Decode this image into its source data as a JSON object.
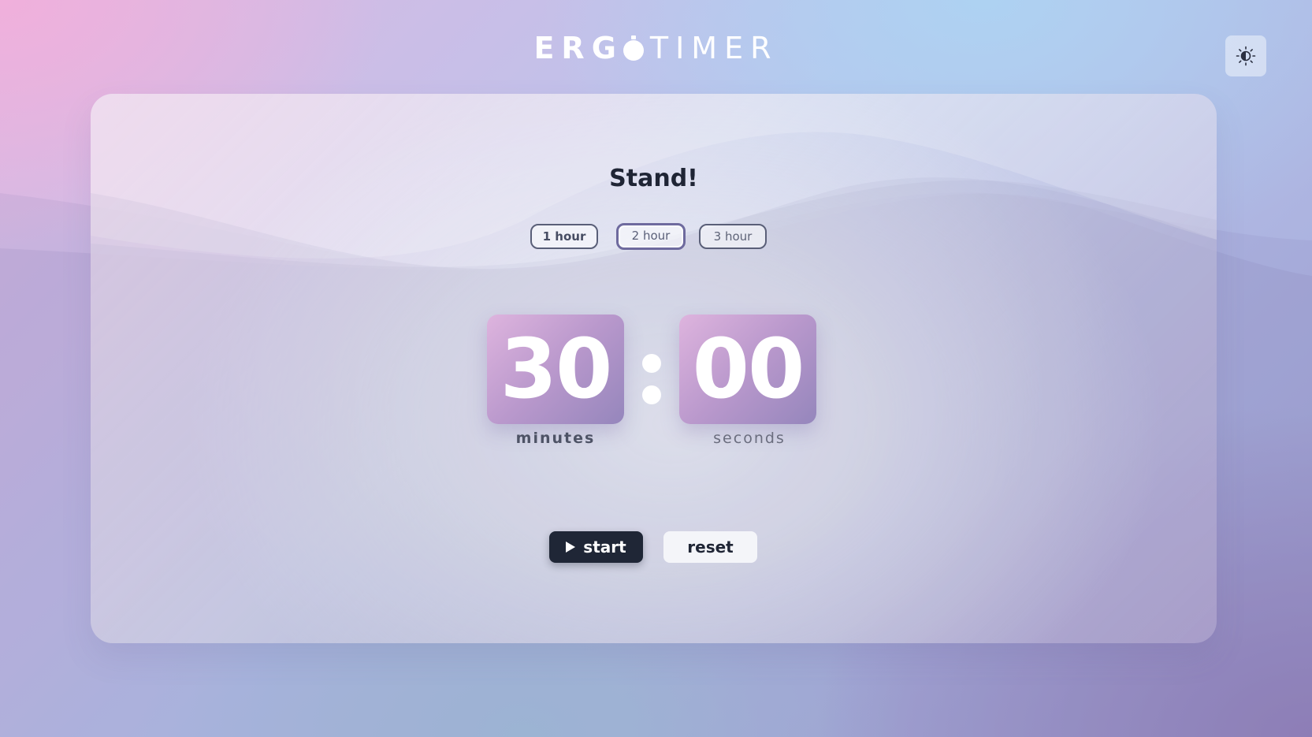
{
  "app": {
    "logo_bold": "ERG",
    "logo_light": "TIMER",
    "theme_toggle_icon": "sun-icon"
  },
  "timer": {
    "title": "Stand!",
    "presets": [
      {
        "label": "1 hour"
      },
      {
        "label": "2 hour"
      },
      {
        "label": "3 hour"
      }
    ],
    "minutes": "30",
    "seconds": "00",
    "minutes_label": "minutes",
    "seconds_label": "seconds"
  },
  "controls": {
    "start_label": "start",
    "start_icon": "play-icon",
    "reset_label": "reset"
  },
  "colors": {
    "dark": "#1f2636",
    "tile_gradient_start": "#deb4de",
    "tile_gradient_end": "#9586bc"
  }
}
